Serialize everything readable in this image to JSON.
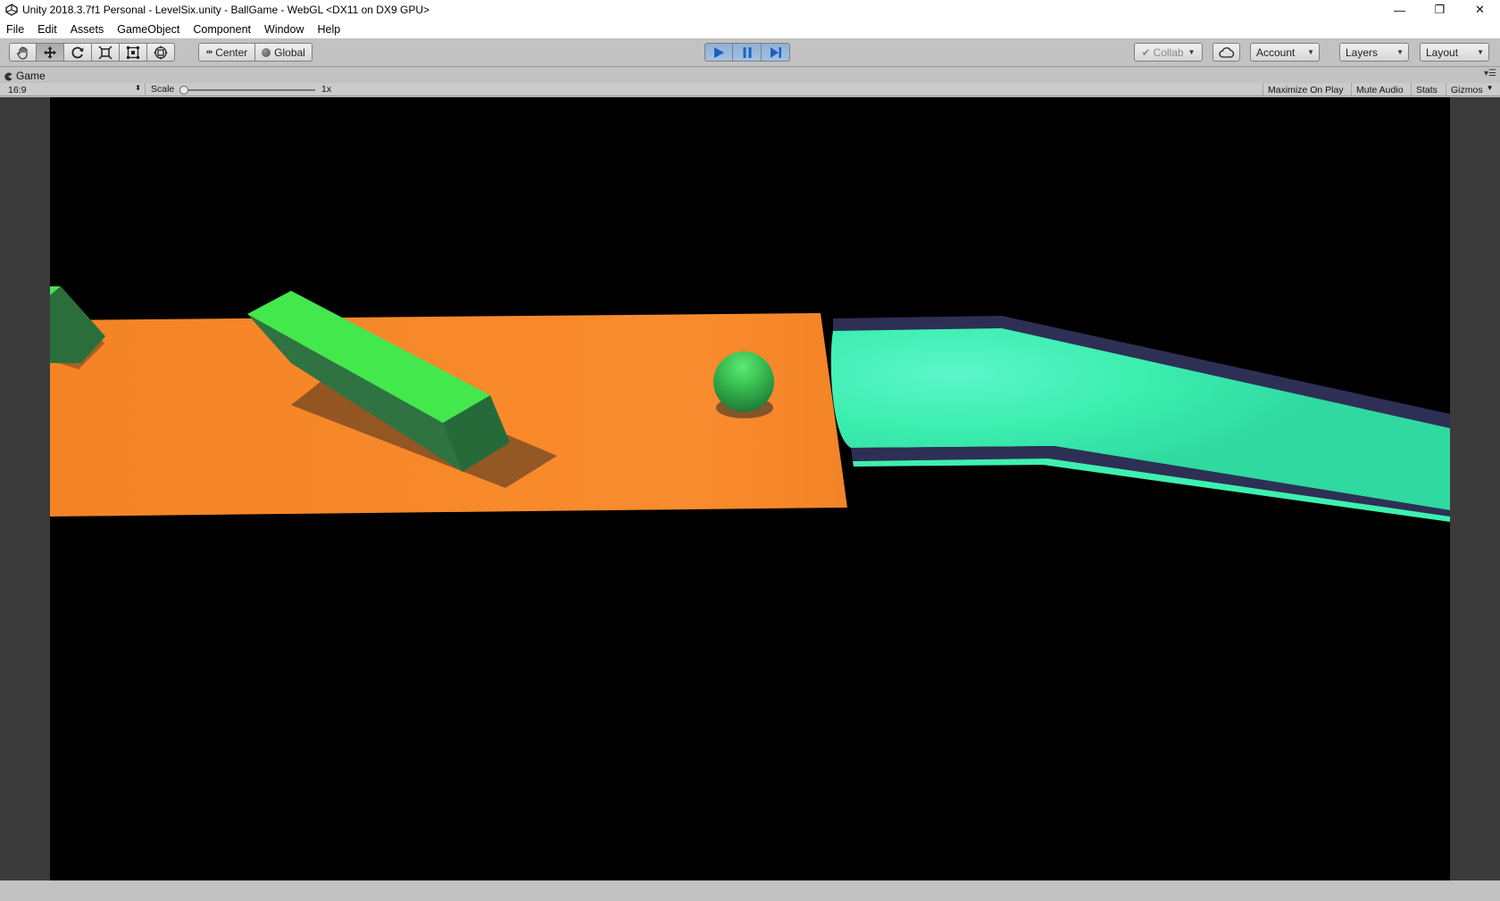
{
  "window": {
    "title": "Unity 2018.3.7f1 Personal - LevelSix.unity - BallGame - WebGL <DX11 on DX9 GPU>",
    "controls": {
      "minimize": "—",
      "restore": "❐",
      "close": "✕"
    }
  },
  "menu": [
    "File",
    "Edit",
    "Assets",
    "GameObject",
    "Component",
    "Window",
    "Help"
  ],
  "toolbar": {
    "tools": [
      "hand-icon",
      "move-icon",
      "rotate-icon",
      "scale-icon",
      "rect-icon",
      "transform-icon"
    ],
    "pivot_mode": "Center",
    "pivot_rotation": "Global",
    "play_state": {
      "play_active": true,
      "paused": false
    },
    "collab": "Collab",
    "account": "Account",
    "layers": "Layers",
    "layout": "Layout"
  },
  "game_tab": {
    "label": "Game",
    "aspect": "16:9",
    "scale_label": "Scale",
    "scale_value": "1x",
    "scale_level": 1,
    "buttons": [
      "Maximize On Play",
      "Mute Audio",
      "Stats",
      "Gizmos"
    ]
  },
  "colors": {
    "chrome": "#c2c2c2",
    "play_active": "#8fb0d6",
    "platform": "#f7892c",
    "obstacle_top": "#43e84d",
    "obstacle_side": "#2d6e3f",
    "ball": "#34b64a",
    "water": "#3ef0b0",
    "rail": "#2e2f55"
  }
}
